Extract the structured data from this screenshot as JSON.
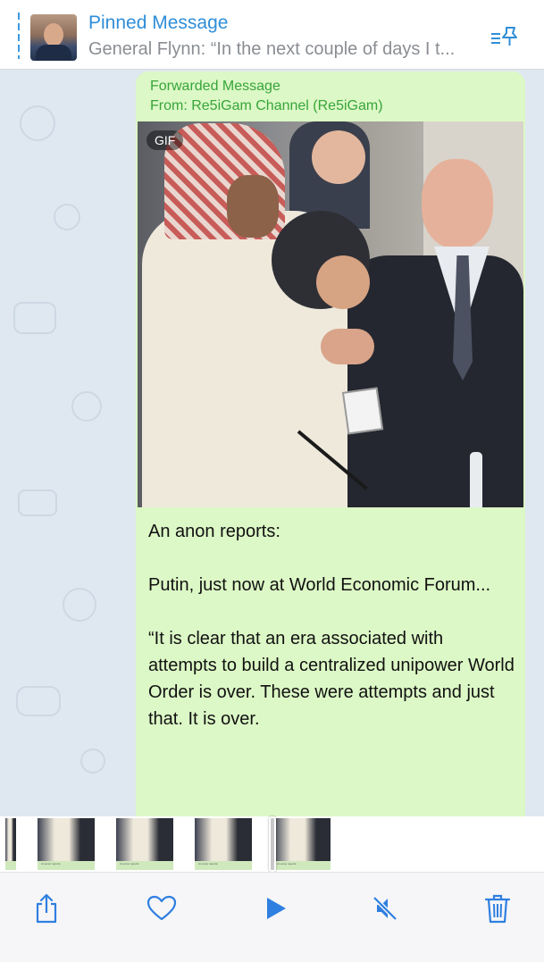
{
  "pinned": {
    "title": "Pinned Message",
    "preview": "General Flynn: “In the next couple of days I t...",
    "avatar_icon": "avatar-photo",
    "action_icon": "pin-list-icon"
  },
  "message": {
    "forward_label": "Forwarded Message",
    "forward_from": "From: Re5iGam Channel (Re5iGam)",
    "media_badge": "GIF",
    "paragraphs": [
      "An anon reports:",
      "Putin, just now at World Economic Forum...",
      "“It is clear that an era associated with attempts to build a centralized unipower World Order is over. These were attempts and just that. It is over."
    ]
  },
  "scrubber": {
    "frame_caption": "An anon reports:"
  },
  "toolbar": {
    "share_icon": "share-icon",
    "like_icon": "heart-icon",
    "play_icon": "play-icon",
    "mute_icon": "speaker-muted-icon",
    "delete_icon": "trash-icon"
  },
  "colors": {
    "accent": "#2f8ed8",
    "bubble": "#dcf8c6",
    "forward_text": "#37a53a",
    "chat_background": "#dfe8f1"
  }
}
